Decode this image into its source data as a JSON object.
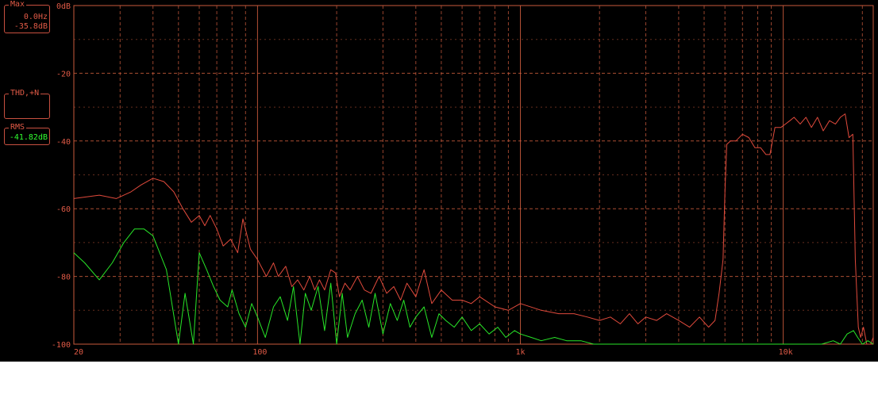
{
  "readouts": {
    "max": {
      "label": "Max",
      "freq": "0.0Hz",
      "level": "-35.8dB"
    },
    "thd": {
      "label": "THD,+N",
      "value": ""
    },
    "rms": {
      "label": "RMS",
      "value": "-41.82dB"
    }
  },
  "colors": {
    "background": "#000000",
    "grid": "#c85a3c",
    "series_red": "#e04a3c",
    "series_green": "#28e628",
    "label": "#e05a46"
  },
  "chart_data": {
    "type": "line",
    "x_scale": "log",
    "xlim": [
      20,
      22000
    ],
    "ylim": [
      -100,
      0
    ],
    "grid": true,
    "x_tick_labels": [
      {
        "value": 20,
        "label": "20"
      },
      {
        "value": 100,
        "label": "100"
      },
      {
        "value": 1000,
        "label": "1k"
      },
      {
        "value": 10000,
        "label": "10k"
      }
    ],
    "y_tick_labels": [
      {
        "value": 0,
        "label": "0dB"
      },
      {
        "value": -20,
        "label": "-20"
      },
      {
        "value": -40,
        "label": "-40"
      },
      {
        "value": -60,
        "label": "-60"
      },
      {
        "value": -80,
        "label": "-80"
      },
      {
        "value": -100,
        "label": "-100"
      }
    ],
    "series": [
      {
        "color": "#e04a3c",
        "x": [
          20,
          25,
          29,
          31,
          33,
          36,
          40,
          44,
          48,
          52,
          56,
          60,
          63,
          66,
          70,
          74,
          79,
          84,
          88,
          94,
          100,
          108,
          115,
          120,
          128,
          135,
          142,
          150,
          158,
          165,
          172,
          180,
          190,
          198,
          205,
          215,
          225,
          240,
          255,
          270,
          290,
          310,
          330,
          350,
          370,
          400,
          430,
          460,
          500,
          550,
          600,
          650,
          700,
          800,
          900,
          1000,
          1200,
          1400,
          1600,
          1800,
          2000,
          2200,
          2400,
          2600,
          2800,
          3000,
          3300,
          3600,
          4000,
          4400,
          4800,
          5200,
          5500,
          5700,
          5900,
          6000,
          6100,
          6300,
          6600,
          7000,
          7400,
          7800,
          8200,
          8600,
          8900,
          9300,
          9800,
          10200,
          10600,
          11000,
          11600,
          12200,
          12800,
          13500,
          14200,
          15000,
          15800,
          16500,
          17200,
          17800,
          18400,
          18800,
          19300,
          19700,
          20200,
          20800,
          21500,
          22000
        ],
        "y": [
          -57,
          -56,
          -57,
          -56,
          -55,
          -53,
          -51,
          -52,
          -55,
          -60,
          -64,
          -62,
          -65,
          -62,
          -66,
          -71,
          -69,
          -73,
          -63,
          -72,
          -75,
          -80,
          -76,
          -80,
          -77,
          -83,
          -81,
          -84,
          -80,
          -84,
          -81,
          -84,
          -78,
          -79,
          -86,
          -82,
          -84,
          -80,
          -84,
          -85,
          -80,
          -85,
          -83,
          -87,
          -82,
          -86,
          -78,
          -88,
          -84,
          -87,
          -87,
          -88,
          -86,
          -89,
          -90,
          -88,
          -90,
          -91,
          -91,
          -92,
          -93,
          -92,
          -94,
          -91,
          -94,
          -92,
          -93,
          -91,
          -93,
          -95,
          -92,
          -95,
          -93,
          -85,
          -75,
          -55,
          -41,
          -40,
          -40,
          -38,
          -39,
          -42,
          -42,
          -44,
          -44,
          -36,
          -36,
          -35,
          -34,
          -33,
          -35,
          -33,
          -36,
          -33,
          -37,
          -34,
          -35,
          -33,
          -32,
          -39,
          -38,
          -75,
          -95,
          -98,
          -95,
          -100,
          -100,
          -98
        ]
      },
      {
        "color": "#28e628",
        "x": [
          20,
          22,
          25,
          28,
          31,
          34,
          37,
          40,
          45,
          50,
          53,
          57,
          60,
          64,
          68,
          72,
          77,
          80,
          85,
          90,
          95,
          100,
          107,
          115,
          122,
          130,
          137,
          145,
          152,
          160,
          170,
          180,
          190,
          200,
          210,
          220,
          235,
          250,
          265,
          280,
          300,
          320,
          340,
          360,
          380,
          400,
          430,
          460,
          490,
          520,
          560,
          600,
          650,
          700,
          760,
          820,
          880,
          950,
          1000,
          1100,
          1200,
          1350,
          1500,
          1700,
          1900,
          2100,
          2300,
          2600,
          3000,
          3500,
          4000,
          5000,
          6000,
          8000,
          10000,
          12000,
          14000,
          15500,
          16500,
          17500,
          18500,
          19200,
          20000,
          21000,
          22000
        ],
        "y": [
          -73,
          -76,
          -81,
          -76,
          -70,
          -66,
          -66,
          -68,
          -78,
          -100,
          -85,
          -100,
          -73,
          -78,
          -83,
          -87,
          -89,
          -84,
          -91,
          -95,
          -88,
          -92,
          -98,
          -89,
          -86,
          -93,
          -83,
          -100,
          -85,
          -90,
          -83,
          -96,
          -82,
          -100,
          -85,
          -98,
          -91,
          -87,
          -95,
          -85,
          -97,
          -88,
          -93,
          -87,
          -95,
          -92,
          -89,
          -98,
          -91,
          -93,
          -95,
          -92,
          -96,
          -94,
          -97,
          -95,
          -98,
          -96,
          -97,
          -98,
          -99,
          -98,
          -99,
          -99,
          -100,
          -100,
          -100,
          -100,
          -100,
          -100,
          -100,
          -100,
          -100,
          -100,
          -100,
          -100,
          -100,
          -99,
          -100,
          -97,
          -96,
          -98,
          -100,
          -99,
          -100
        ]
      }
    ]
  }
}
